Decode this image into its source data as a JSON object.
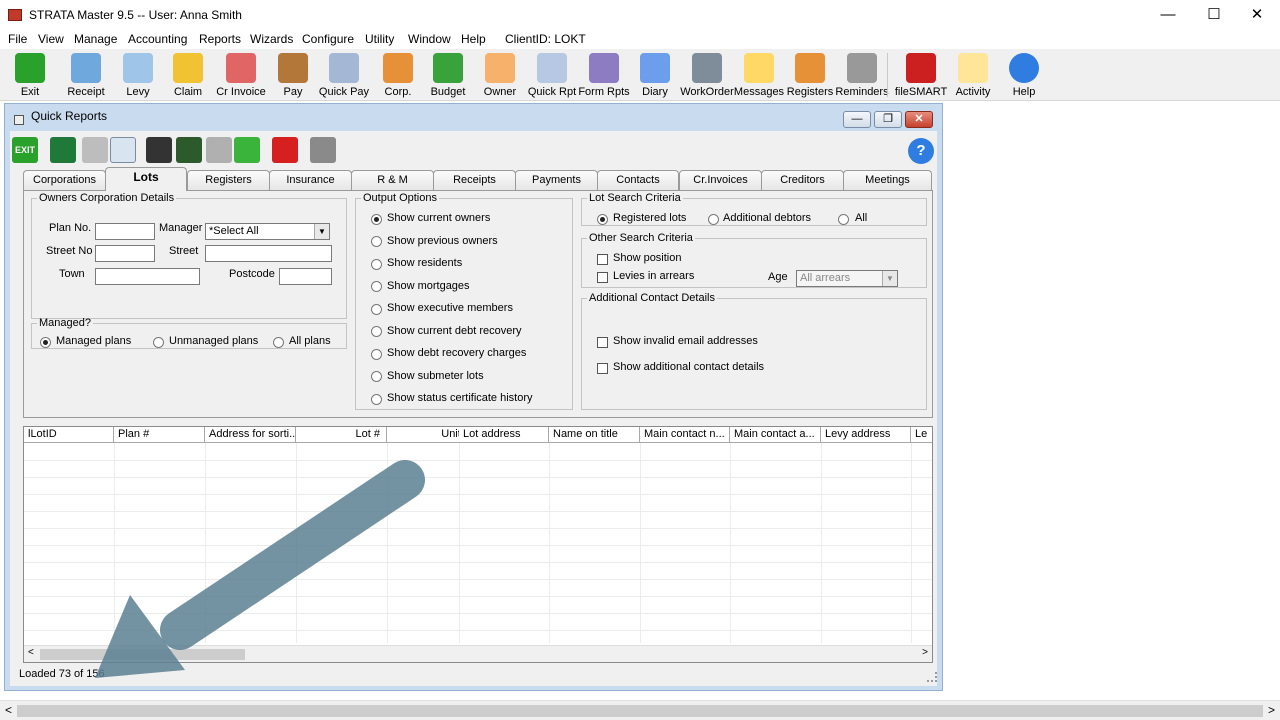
{
  "window": {
    "title": "STRATA Master 9.5 -- User: Anna Smith",
    "minimize": "—",
    "maximize": "☐",
    "close": "✕"
  },
  "menu": [
    "File",
    "View",
    "Manage",
    "Accounting",
    "Reports",
    "Wizards",
    "Configure",
    "Utility",
    "Window",
    "Help",
    "ClientID: LOKT"
  ],
  "toolbar": [
    {
      "label": "Exit",
      "icon": "exit-icon",
      "color": "#2aa12a"
    },
    {
      "label": "Receipt",
      "icon": "receipt-icon",
      "color": "#6fa8dc"
    },
    {
      "label": "Levy",
      "icon": "levy-icon",
      "color": "#9fc5e8"
    },
    {
      "label": "Claim",
      "icon": "lightning-icon",
      "color": "#f1c232"
    },
    {
      "label": "Cr Invoice",
      "icon": "invoice-icon",
      "color": "#e06666"
    },
    {
      "label": "Pay",
      "icon": "pay-icon",
      "color": "#b4773a"
    },
    {
      "label": "Quick Pay",
      "icon": "quick-pay-icon",
      "color": "#a4b8d6"
    },
    {
      "label": "Corp.",
      "icon": "building-icon",
      "color": "#e69138"
    },
    {
      "label": "Budget",
      "icon": "dollar-icon",
      "color": "#38a33b"
    },
    {
      "label": "Owner",
      "icon": "owner-icon",
      "color": "#f6b26b"
    },
    {
      "label": "Quick Rpt",
      "icon": "quick-report-icon",
      "color": "#b7c9e2"
    },
    {
      "label": "Form Rpts",
      "icon": "printer-icon",
      "color": "#8e7cc3"
    },
    {
      "label": "Diary",
      "icon": "calendar-icon",
      "color": "#6d9eeb"
    },
    {
      "label": "WorkOrder",
      "icon": "tools-icon",
      "color": "#7f8c9a"
    },
    {
      "label": "Messages",
      "icon": "message-icon",
      "color": "#ffd966"
    },
    {
      "label": "Registers",
      "icon": "registers-icon",
      "color": "#e69138"
    },
    {
      "label": "Reminders",
      "icon": "checklist-icon",
      "color": "#999999"
    },
    {
      "label": "fileSMART",
      "icon": "filesmart-icon",
      "color": "#cc1f1f"
    },
    {
      "label": "Activity",
      "icon": "clipboard-icon",
      "color": "#ffe599"
    },
    {
      "label": "Help",
      "icon": "help-icon",
      "color": "#2f7de1"
    }
  ],
  "quick_reports": {
    "title": "Quick Reports",
    "inner_toolbar": [
      {
        "icon": "exit-icon",
        "label": "EXIT"
      },
      {
        "icon": "excel-icon"
      },
      {
        "icon": "print-icon"
      },
      {
        "icon": "print-preview-icon"
      },
      {
        "icon": "binoculars-icon"
      },
      {
        "icon": "binoculars-add-icon"
      },
      {
        "icon": "link-icon"
      },
      {
        "icon": "add-icon"
      },
      {
        "icon": "record-icon"
      },
      {
        "icon": "align-icon"
      }
    ],
    "tabs": [
      "Corporations",
      "Lots",
      "Registers",
      "Insurance",
      "R & M",
      "Receipts",
      "Payments",
      "Contacts",
      "Cr.Invoices",
      "Creditors",
      "Meetings"
    ],
    "active_tab": "Lots",
    "owners_corp": {
      "legend": "Owners Corporation Details",
      "plan_no_label": "Plan No.",
      "manager_label": "Manager",
      "manager_value": "*Select All",
      "street_no_label": "Street No",
      "street_label": "Street",
      "town_label": "Town",
      "postcode_label": "Postcode"
    },
    "managed": {
      "legend": "Managed?",
      "options": [
        "Managed plans",
        "Unmanaged plans",
        "All plans"
      ],
      "selected": 0
    },
    "output_options": {
      "legend": "Output Options",
      "options": [
        "Show current owners",
        "Show previous owners",
        "Show residents",
        "Show mortgages",
        "Show executive members",
        "Show current debt recovery",
        "Show debt recovery charges",
        "Show submeter lots",
        "Show status certificate history"
      ],
      "selected": 0
    },
    "lot_search": {
      "legend": "Lot Search Criteria",
      "options": [
        "Registered lots",
        "Additional debtors",
        "All"
      ],
      "selected": 0
    },
    "other_search": {
      "legend": "Other Search Criteria",
      "show_position": "Show position",
      "levies_in_arrears": "Levies in arrears",
      "age_label": "Age",
      "age_value": "All arrears"
    },
    "additional_contact": {
      "legend": "Additional Contact Details",
      "invalid_email": "Show invalid email addresses",
      "additional_details": "Show additional contact details"
    },
    "grid_columns": [
      "lLotID",
      "Plan #",
      "Address for sorti...",
      "Lot #",
      "Unit #",
      "Lot address",
      "Name on title",
      "Main contact n...",
      "Main contact a...",
      "Levy address",
      "Le"
    ],
    "status": "Loaded 73 of 156"
  }
}
